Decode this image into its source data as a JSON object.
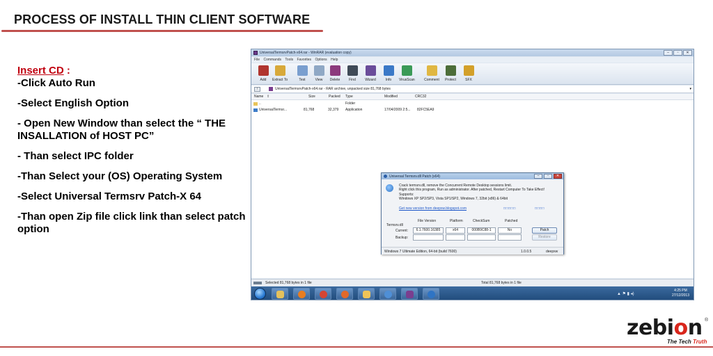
{
  "slide": {
    "title": "PROCESS OF INSTALL THIN CLIENT SOFTWARE",
    "heading": "Insert CD",
    "heading_colon": " :",
    "steps": [
      "-Click Auto Run",
      "-Select English Option",
      "- Open New Window than select the “ THE INSALLATION of HOST PC”",
      "- Than select IPC folder",
      "-Than Select your (OS) Operating System",
      "-Select Universal Termsrv Patch-X 64",
      "-Than open Zip file click link than select patch option"
    ],
    "colors": {
      "title_rule": "#c0504d",
      "heading": "#c0000f"
    }
  },
  "logo": {
    "word_start": "zebi",
    "word_o": "o",
    "word_end": "n",
    "registered": "®",
    "tagline_start": "The Tech ",
    "tagline_end": "Truth",
    "colors": {
      "accent": "#d9261c"
    }
  },
  "winrar": {
    "title": "UniversalTermsrvPatch-x64.rar - WinRAR (evaluation copy)",
    "window_buttons": [
      "–",
      "▫",
      "✕"
    ],
    "menu": [
      "File",
      "Commands",
      "Tools",
      "Favorites",
      "Options",
      "Help"
    ],
    "toolbar": [
      {
        "label": "Add",
        "icon": "add-books-icon",
        "color": "#b0352f"
      },
      {
        "label": "Extract To",
        "icon": "folder-extract-icon",
        "color": "#d8a93a"
      },
      {
        "label": "Test",
        "icon": "test-archive-icon",
        "color": "#7a9fcf"
      },
      {
        "label": "View",
        "icon": "view-book-icon",
        "color": "#8fa8c5"
      },
      {
        "label": "Delete",
        "icon": "delete-books-icon",
        "color": "#8c3a7d"
      },
      {
        "label": "Find",
        "icon": "binoculars-icon",
        "color": "#3f4a57"
      },
      {
        "label": "Wizard",
        "icon": "wizard-icon",
        "color": "#6a4c9a"
      },
      {
        "label": "Info",
        "icon": "info-icon",
        "color": "#3b79c7"
      },
      {
        "label": "VirusScan",
        "icon": "virusscan-icon",
        "color": "#3a9a57"
      },
      {
        "label": "Comment",
        "icon": "comment-pen-icon",
        "color": "#e0b742"
      },
      {
        "label": "Protect",
        "icon": "shield-icon",
        "color": "#4d6e3a"
      },
      {
        "label": "SFX",
        "icon": "sfx-icon",
        "color": "#d3a02a"
      }
    ],
    "path": "UniversalTermsrvPatch-x64.rar - RAR archive, unpacked size 81,768 bytes",
    "columns": [
      "Name",
      "Size",
      "Packed",
      "Type",
      "Modified",
      "CRC32"
    ],
    "sort_glyph": "⇧",
    "rows": [
      {
        "name": "..",
        "size": "",
        "packed": "",
        "type": "Folder",
        "modified": "",
        "crc": ""
      },
      {
        "name": "UniversalTermsr...",
        "size": "81,768",
        "packed": "32,379",
        "type": "Application",
        "modified": "17/04/2009 2:5...",
        "crc": "82FC5EA9"
      }
    ],
    "status_left": "Selected 81,768 bytes in 1 file",
    "status_right": "Total 81,768 bytes in 1 file"
  },
  "patch_dialog": {
    "title": "Universal Termsrv.dll Patch  (x64)",
    "window_buttons": [
      "–",
      "▫",
      "✕"
    ],
    "line1": "Crack termsrv.dll, remove the Concurrent Remote Desktop sessions limit.",
    "line2": "Right click this program, Run as administrator.     After patched, Restart Computer To Take Effect!",
    "line3": "Supports:",
    "line4": "Windows XP SP2/SP3, Vista SP1/SP2,  Windows 7, 32bit (x86) & 64bit",
    "link": "Get new version from deepxw.blogspot.com",
    "boxes_a": "□□□□□",
    "boxes_b": "□□□□",
    "headers": [
      "File Version",
      "Platform",
      "CheckSum",
      "Patched"
    ],
    "file_label": "Termsrv.dll",
    "current_label": "Current:",
    "backup_label": "Backup:",
    "current": {
      "version": "6.1.7600.16385",
      "platform": "x64",
      "checksum": "000B9C88-1",
      "patched": "No"
    },
    "patch_button": "Patch",
    "restore_button": "Restore",
    "status_os": "Windows 7 Ultimate Edition, 64-bit (build 7600)",
    "status_version": "1.0.0.5",
    "status_author": "deepxw"
  },
  "taskbar": {
    "tray_icons": "▲ ⚑ ▮ ◂)",
    "time": "4:25 PM",
    "date": "27/12/2013"
  }
}
